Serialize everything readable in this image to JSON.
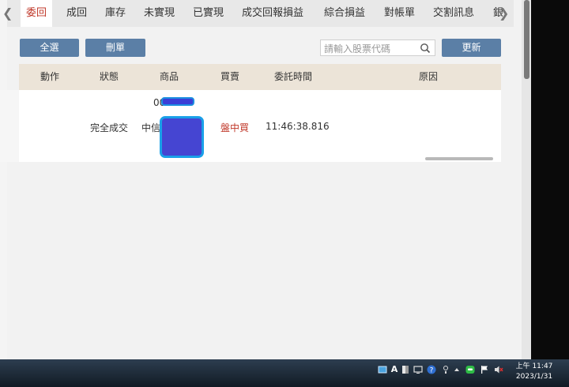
{
  "tabs": {
    "prev_arrow": "❮",
    "next_arrow": "❯",
    "items": [
      "委回",
      "成回",
      "庫存",
      "未實現",
      "已實現",
      "成交回報損益",
      "綜合損益",
      "對帳單",
      "交割訊息",
      "銀"
    ]
  },
  "toolbar": {
    "select_all_label": "全選",
    "delete_label": "刪單",
    "search_placeholder": "請輸入股票代碼",
    "refresh_label": "更新"
  },
  "table": {
    "headers": [
      "動作",
      "狀態",
      "商品",
      "買賣",
      "委託時間",
      "原因"
    ],
    "rows": [
      {
        "action": "",
        "status": "完全成交",
        "product_code": "00",
        "product_name": "中信",
        "side": "盤中買",
        "time": "11:46:38.816",
        "reason": ""
      }
    ]
  },
  "taskbar": {
    "time": "上午 11:47",
    "date": "2023/1/31",
    "ime_label": "A"
  },
  "colors": {
    "accent_red": "#c0392b",
    "button_blue": "#5b7fa6",
    "header_beige": "#ece4d8",
    "redaction_fill": "#4545d2",
    "redaction_border": "#1aa0e8"
  }
}
